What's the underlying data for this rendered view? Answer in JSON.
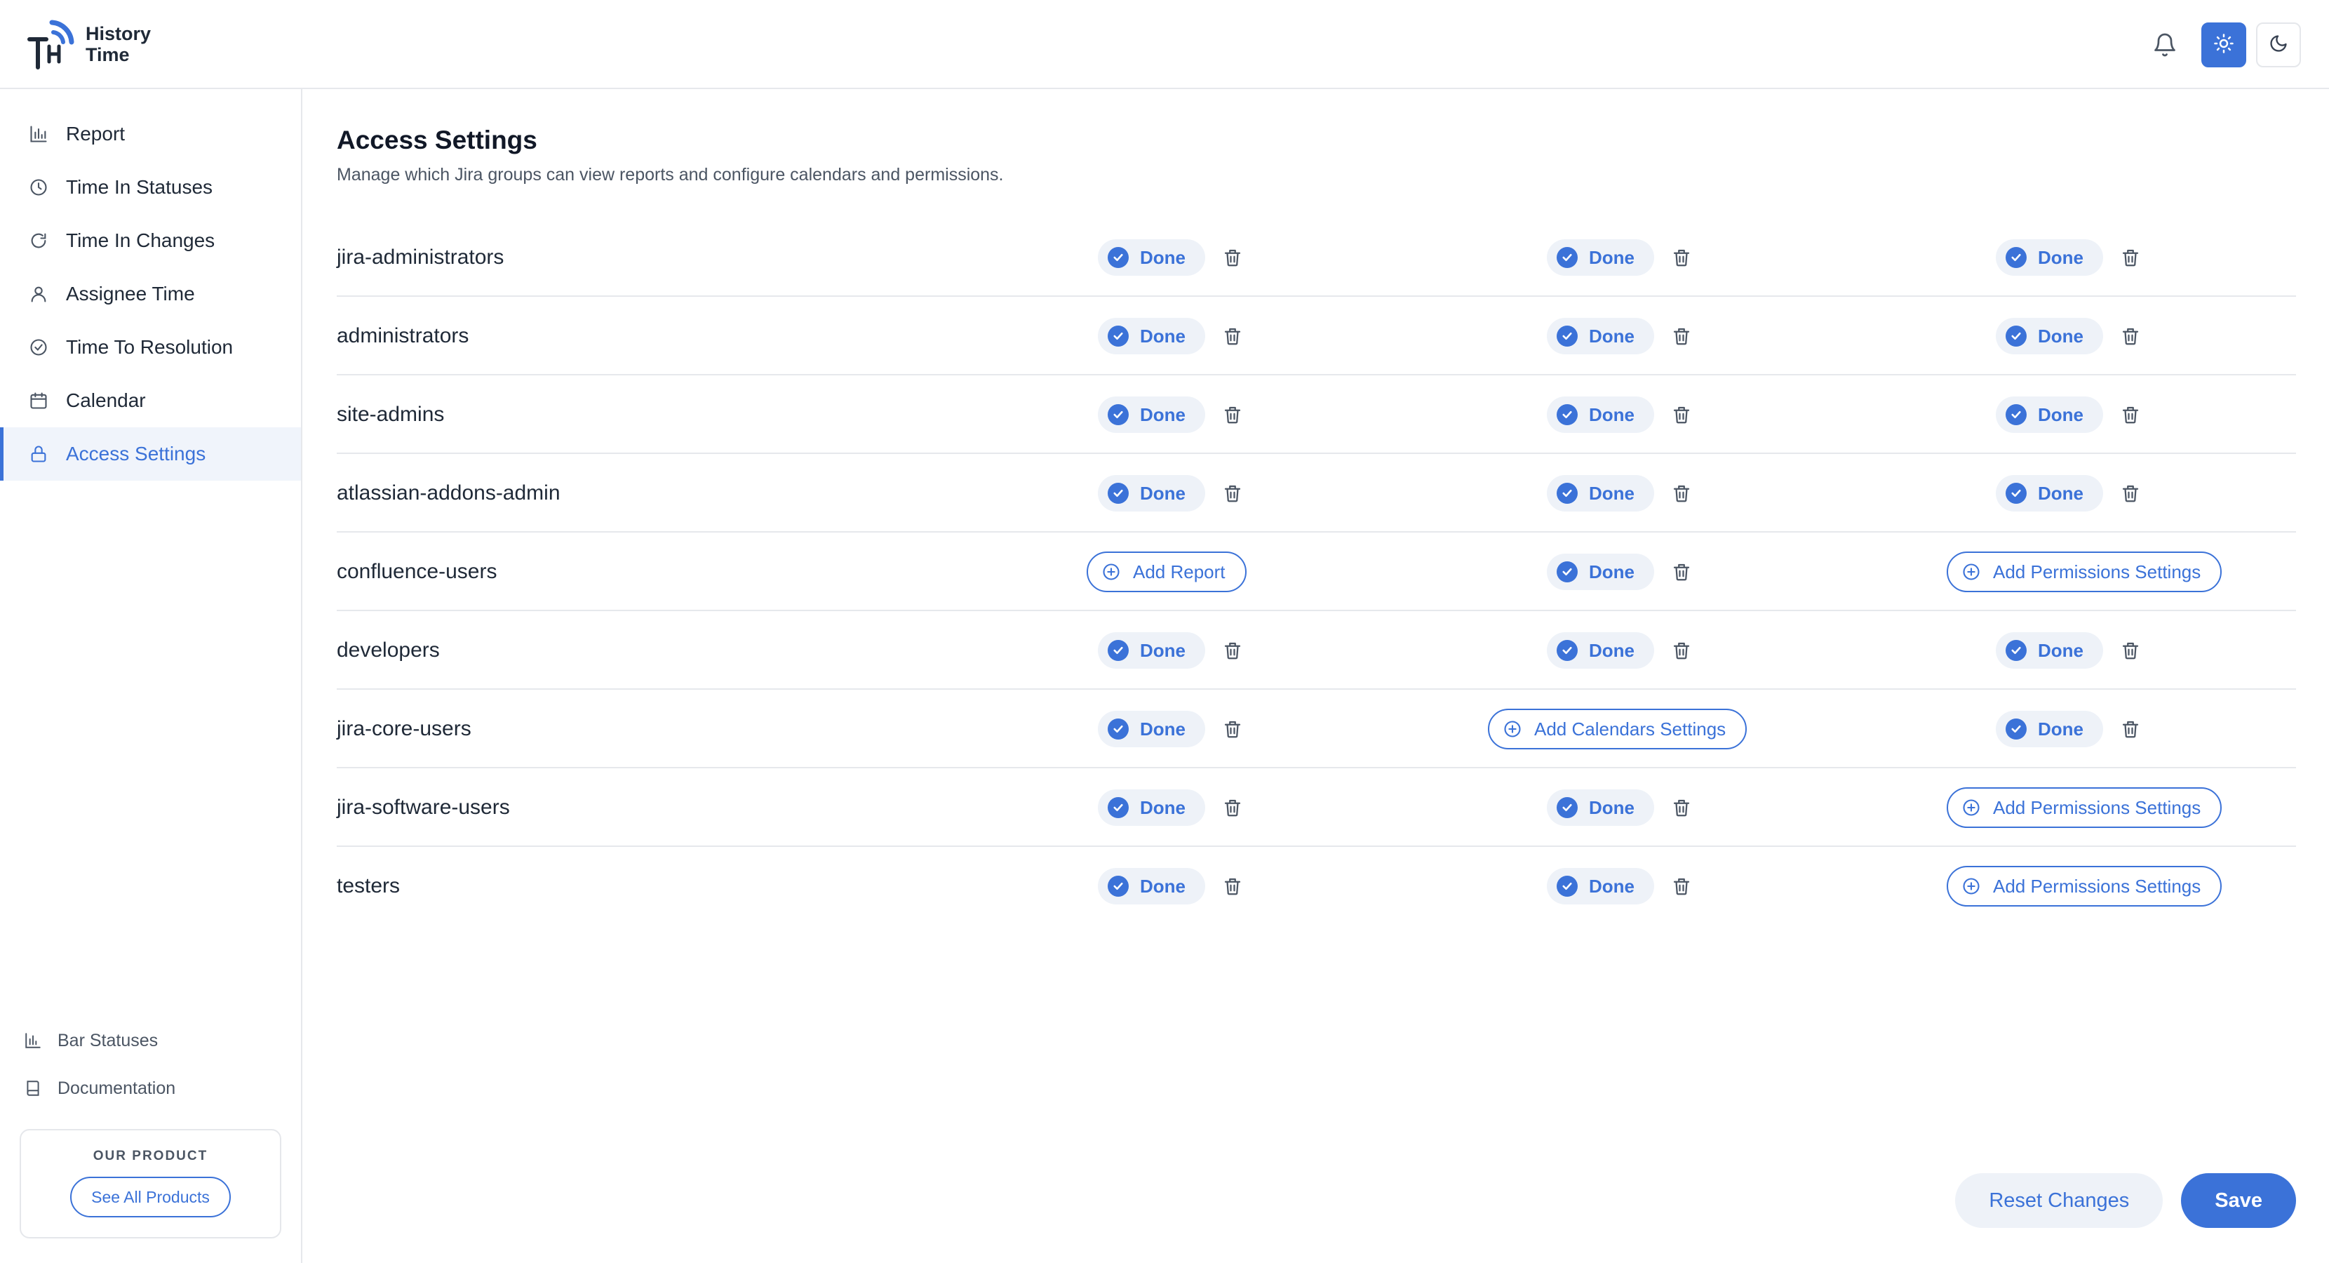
{
  "app": {
    "logo_title_line1": "History",
    "logo_title_line2": "Time"
  },
  "header": {
    "bell_icon": "bell-icon",
    "light_theme_icon": "sun-icon",
    "dark_theme_icon": "moon-icon",
    "active_theme": "light"
  },
  "sidebar": {
    "items": [
      {
        "label": "Report",
        "icon": "bar-chart-icon"
      },
      {
        "label": "Time In Statuses",
        "icon": "clock-icon"
      },
      {
        "label": "Time In Changes",
        "icon": "refresh-icon"
      },
      {
        "label": "Assignee Time",
        "icon": "user-icon"
      },
      {
        "label": "Time To Resolution",
        "icon": "check-circle-icon"
      },
      {
        "label": "Calendar",
        "icon": "calendar-icon"
      },
      {
        "label": "Access Settings",
        "icon": "lock-icon",
        "active": true
      }
    ],
    "bottom_links": [
      {
        "label": "Bar Statuses",
        "icon": "bar-chart-icon"
      },
      {
        "label": "Documentation",
        "icon": "book-icon"
      }
    ],
    "product_card": {
      "label": "OUR PRODUCT",
      "button": "See All Products"
    }
  },
  "main": {
    "title": "Access Settings",
    "subtitle": "Manage which Jira groups can view reports and configure calendars and permissions.",
    "done_label": "Done",
    "add_report_label": "Add Report",
    "add_calendars_label": "Add Calendars Settings",
    "add_permissions_label": "Add Permissions Settings",
    "rows": [
      {
        "group": "jira-administrators",
        "report": "done",
        "calendars": "done",
        "permissions": "done"
      },
      {
        "group": "administrators",
        "report": "done",
        "calendars": "done",
        "permissions": "done"
      },
      {
        "group": "site-admins",
        "report": "done",
        "calendars": "done",
        "permissions": "done"
      },
      {
        "group": "atlassian-addons-admin",
        "report": "done",
        "calendars": "done",
        "permissions": "done"
      },
      {
        "group": "confluence-users",
        "report": "add",
        "calendars": "done",
        "permissions": "add"
      },
      {
        "group": "developers",
        "report": "done",
        "calendars": "done",
        "permissions": "done"
      },
      {
        "group": "jira-core-users",
        "report": "done",
        "calendars": "add",
        "permissions": "done"
      },
      {
        "group": "jira-software-users",
        "report": "done",
        "calendars": "done",
        "permissions": "add"
      },
      {
        "group": "testers",
        "report": "done",
        "calendars": "done",
        "permissions": "add"
      }
    ],
    "reset_label": "Reset Changes",
    "save_label": "Save"
  },
  "colors": {
    "accent": "#3b72d8",
    "pill_bg": "#eef2f8",
    "border": "#e6e8ec"
  }
}
